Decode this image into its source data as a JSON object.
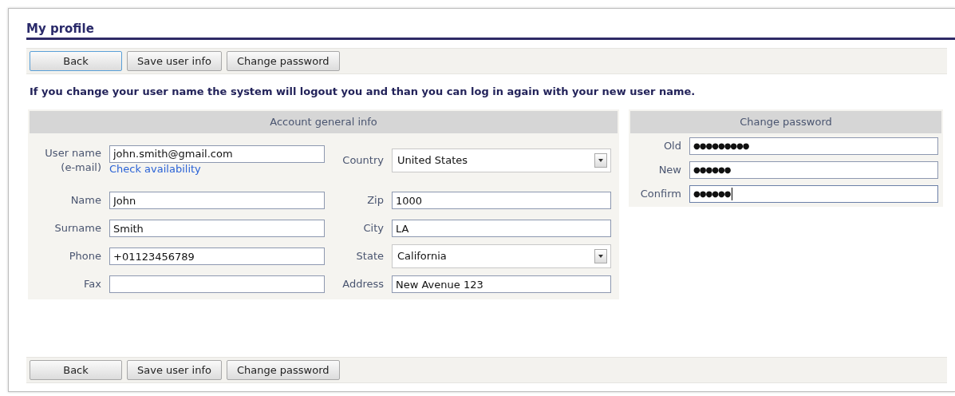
{
  "title": "My profile",
  "toolbar_top": [
    {
      "label": "Back",
      "focused": true
    },
    {
      "label": "Save user info",
      "focused": false
    },
    {
      "label": "Change password",
      "focused": false
    }
  ],
  "notice": "If you change your user name the system will logout you and than you can log in again with your new user name.",
  "account": {
    "heading": "Account general info",
    "rows": [
      {
        "left": {
          "label": "User name (e-mail)",
          "kind": "text",
          "value": "john.smith@gmail.com",
          "link": "Check availability"
        },
        "right": {
          "label": "Country",
          "kind": "select",
          "value": "United States"
        }
      },
      {
        "left": {
          "label": "Name",
          "kind": "text",
          "value": "John"
        },
        "right": {
          "label": "Zip",
          "kind": "text",
          "value": "1000"
        }
      },
      {
        "left": {
          "label": "Surname",
          "kind": "text",
          "value": "Smith"
        },
        "right": {
          "label": "City",
          "kind": "text",
          "value": "LA"
        }
      },
      {
        "left": {
          "label": "Phone",
          "kind": "text",
          "value": "+01123456789"
        },
        "right": {
          "label": "State",
          "kind": "select",
          "value": "California"
        }
      },
      {
        "left": {
          "label": "Fax",
          "kind": "text"
        },
        "right": {
          "label": "Address",
          "kind": "text",
          "value": "New Avenue 123"
        }
      }
    ]
  },
  "password": {
    "heading": "Change password",
    "rows": [
      {
        "label": "Old",
        "value": "●●●●●●●●●",
        "focused": false
      },
      {
        "label": "New",
        "value": "●●●●●●",
        "focused": false
      },
      {
        "label": "Confirm",
        "value": "●●●●●●",
        "focused": true
      }
    ]
  },
  "toolbar_bottom": [
    {
      "label": "Back",
      "focused": false
    },
    {
      "label": "Save user info",
      "focused": false
    },
    {
      "label": "Change password",
      "focused": false
    }
  ]
}
